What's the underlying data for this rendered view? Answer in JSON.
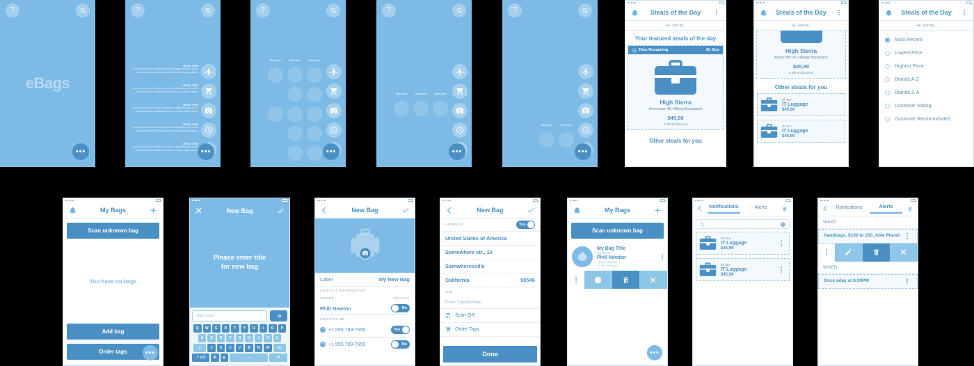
{
  "brand": {
    "logo": "eBags",
    "accent": "#4a90c4",
    "wireframe_bg": "#7dbbe6"
  },
  "menu": {
    "item_title": "MENU ITEM",
    "item_body": "Lorem ipsum dolor sit amet, consectetur adipisicing elit, sed do eiusmod tempor incididunt ut labore et dolore magna aliqua.",
    "grid_label": "Menu item"
  },
  "icons": {
    "help": "?",
    "search": "search-icon",
    "more": "•••",
    "plane": "plane-icon",
    "cart": "cart-icon",
    "camera": "camera-icon",
    "clock": "clock-icon",
    "feather": "feather-icon"
  },
  "steals": {
    "title": "Steals of the Day",
    "sort_label": "Sort by...",
    "featured_header": "Your featured steals of the day",
    "time_label": "Time Remaining",
    "time_value": "5h 31m",
    "product": {
      "brand": "High Sierra",
      "name": "Ascender 40 Hiking Backpack",
      "price": "$45,99",
      "stock": "5 left at this price"
    },
    "other_header": "Other steals for you",
    "other_items": [
      {
        "time": "5h 31m",
        "title": "IT Luggage",
        "price": "$45,99"
      },
      {
        "time": "5h 31m",
        "title": "IT Luggage",
        "price": "$45,99"
      }
    ]
  },
  "sort_options": [
    {
      "label": "Most Recent",
      "selected": true
    },
    {
      "label": "Lowest Price",
      "selected": false
    },
    {
      "label": "Highest Price",
      "selected": false
    },
    {
      "label": "Brands A-Z",
      "selected": false
    },
    {
      "label": "Brands Z-A",
      "selected": false
    },
    {
      "label": "Customer Rating",
      "selected": false
    },
    {
      "label": "Customer Recommended",
      "selected": false
    }
  ],
  "my_bags_empty": {
    "title": "My Bags",
    "scan_label": "Scan unknown bag",
    "empty_text": "You have no bags",
    "add_label": "Add bag",
    "order_label": "Order tags"
  },
  "new_bag_keyboard": {
    "title": "New Bag",
    "hero_line1": "Please enter title",
    "hero_line2": "for new bag",
    "input_placeholder": "Type here|",
    "keys_row1": [
      "Q",
      "W",
      "E",
      "R",
      "T",
      "Y",
      "U",
      "I",
      "O",
      "P"
    ],
    "keys_row2": [
      "A",
      "S",
      "D",
      "F",
      "G",
      "H",
      "J",
      "K",
      "L"
    ],
    "keys_row3": [
      "Z",
      "X",
      "C",
      "V",
      "B",
      "N",
      "M"
    ],
    "key_shift": "⬆",
    "key_backspace": "⬅",
    "key_numbers": ".? 123",
    "key_settings": "⚙",
    "key_mic": "🎤",
    "key_space": "—",
    "key_enter": "⏎"
  },
  "new_bag_detail": {
    "title": "New Bag",
    "label_caption": "Label",
    "label_value": "My New Bag",
    "contact_information": "CONTACT INFORMATION",
    "owner_caption": "OWNER",
    "privacy_caption": "PRIVACY",
    "owner_value": "Phill Newton",
    "owner_toggle": "No",
    "contact_me": "CONTACT ME",
    "phones": [
      {
        "number": "+1 555 789-7656",
        "toggle": "Yes",
        "on": true
      },
      {
        "number": "+1 555 789-7656",
        "toggle": "No",
        "on": false
      }
    ]
  },
  "new_bag_address": {
    "title": "New Bag",
    "address_caption": "ADDRESS",
    "address_toggle": "Yes",
    "country": "United States of America",
    "street": "Somewhere str., 10",
    "city": "Somwheresville",
    "state": "California",
    "zip": "90546",
    "tag_caption": "TAG",
    "tag_placeholder": "Enter Tag Number",
    "scan_qr": "Scan QR",
    "order_tags": "Order Tags",
    "done": "Done"
  },
  "my_bags_list": {
    "title": "My Bags",
    "scan_label": "Scan unknown bag",
    "bag": {
      "title": "My Bag Title",
      "code": "454564564",
      "owner": "Phill Newton",
      "phone1": "+1 555 3456465",
      "phone2": "+1 465 5645646"
    },
    "actions": [
      "kebab-icon",
      "info-icon",
      "trash-icon",
      "close-icon"
    ]
  },
  "notifications": {
    "tab_notifications": "Notifications",
    "tab_alerts": "Alerts",
    "search_placeholder": "",
    "items": [
      {
        "time": "5h 31m",
        "title": "IT Luggage",
        "price": "$45,99"
      },
      {
        "time": "5h 31m",
        "title": "IT Luggage",
        "price": "$45,99"
      }
    ]
  },
  "alerts": {
    "tab_notifications": "Notifications",
    "tab_alerts": "Alerts",
    "what_caption": "WHAT",
    "what_value": "Handbags, $100 to 250, Able Planet",
    "when_caption": "WHEN",
    "when_value": "Once aday at 8:00PM",
    "actions": [
      "kebab-icon",
      "edit-icon",
      "trash-icon",
      "close-icon"
    ]
  }
}
